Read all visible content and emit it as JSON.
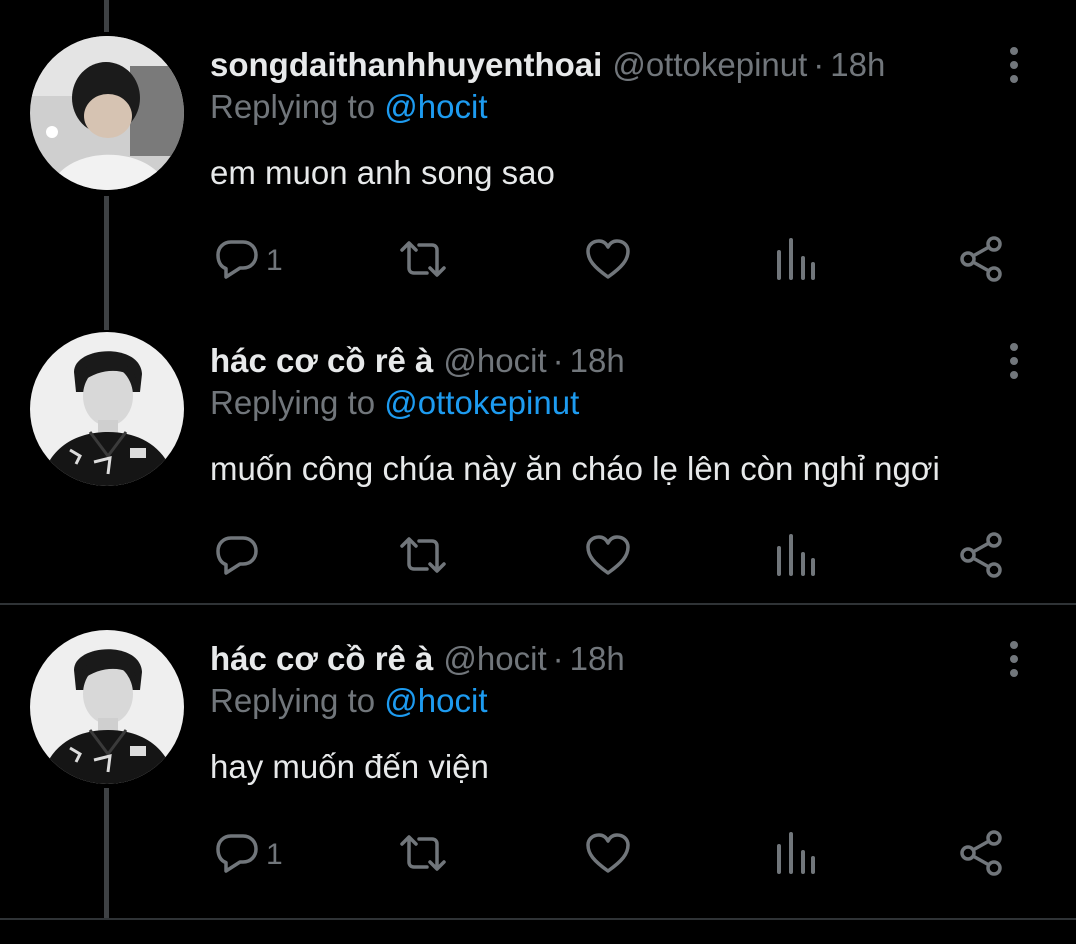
{
  "tweets": [
    {
      "display_name": "songdaithanhhuyenthoai",
      "handle": "@ottokepinut",
      "separator": "·",
      "time": "18h",
      "replying_prefix": "Replying to",
      "replying_to": "@hocit",
      "text": "em muon anh song sao",
      "reply_count": "1",
      "avatar_icon": "person-photo-light"
    },
    {
      "display_name": "hác cơ cồ rê à",
      "handle": "@hocit",
      "separator": "·",
      "time": "18h",
      "replying_prefix": "Replying to",
      "replying_to": "@ottokepinut",
      "text": "muốn công chúa này ăn cháo lẹ lên còn nghỉ ngơi",
      "reply_count": "",
      "avatar_icon": "person-photo-dark"
    },
    {
      "display_name": "hác cơ cồ rê à",
      "handle": "@hocit",
      "separator": "·",
      "time": "18h",
      "replying_prefix": "Replying to",
      "replying_to": "@hocit",
      "text": "hay muốn đến viện",
      "reply_count": "1",
      "avatar_icon": "person-photo-dark"
    }
  ],
  "icons": {
    "reply": "reply-icon",
    "retweet": "retweet-icon",
    "like": "heart-icon",
    "views": "views-icon",
    "share": "share-icon",
    "more": "more-vertical-icon"
  },
  "colors": {
    "background": "#000000",
    "primary_text": "#e7e9ea",
    "secondary_text": "#71767b",
    "mention": "#1d9bf0",
    "thread_line": "#3e4144",
    "divider": "#2f3336"
  }
}
